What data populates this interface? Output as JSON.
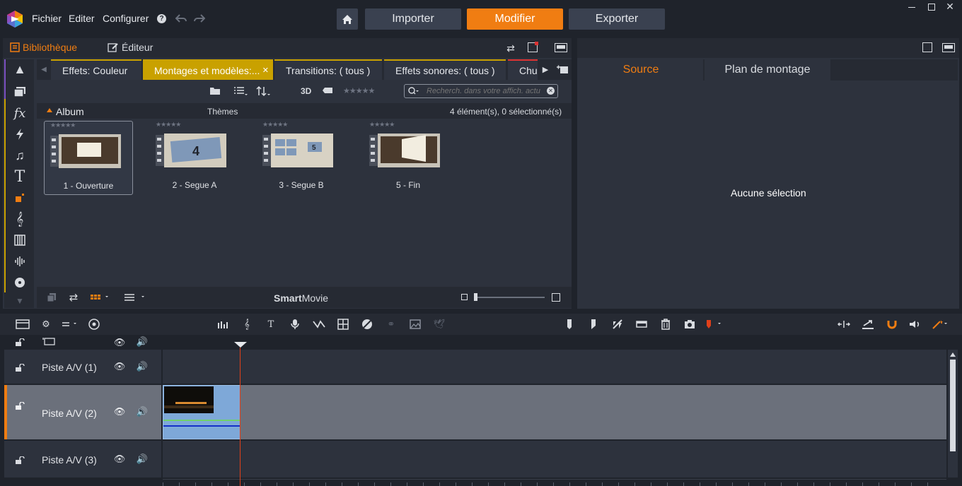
{
  "menu": {
    "file": "Fichier",
    "edit": "Editer",
    "configure": "Configurer"
  },
  "modes": {
    "import": "Importer",
    "edit": "Modifier",
    "export": "Exporter"
  },
  "library": {
    "tab_library": "Bibliothèque",
    "tab_editor": "Éditeur",
    "tabs": [
      "Effets: Couleur",
      "Montages et modèles:...",
      "Transitions: ( tous )",
      "Effets sonores: ( tous )",
      "Chu"
    ],
    "view_3d": "3D",
    "search_placeholder": "Recherch. dans votre affich. actu",
    "album_label": "Album",
    "album_category": "Thèmes",
    "count_text": "4 élément(s), 0 sélectionné(s)",
    "items": [
      {
        "label": "1 - Ouverture"
      },
      {
        "label": "2 - Segue A"
      },
      {
        "label": "3 - Segue B"
      },
      {
        "label": "5 - Fin"
      }
    ],
    "smartmovie_bold": "Smart",
    "smartmovie_rest": "Movie"
  },
  "preview": {
    "tab_source": "Source",
    "tab_timeline": "Plan de montage",
    "empty_text": "Aucune sélection"
  },
  "timeline": {
    "tracks": [
      "Piste A/V (1)",
      "Piste A/V (2)",
      "Piste A/V (3)"
    ]
  },
  "colors": {
    "accent": "#f07d12",
    "tab_yellow": "#c9a100",
    "clip_blue": "#7ea8d8"
  }
}
